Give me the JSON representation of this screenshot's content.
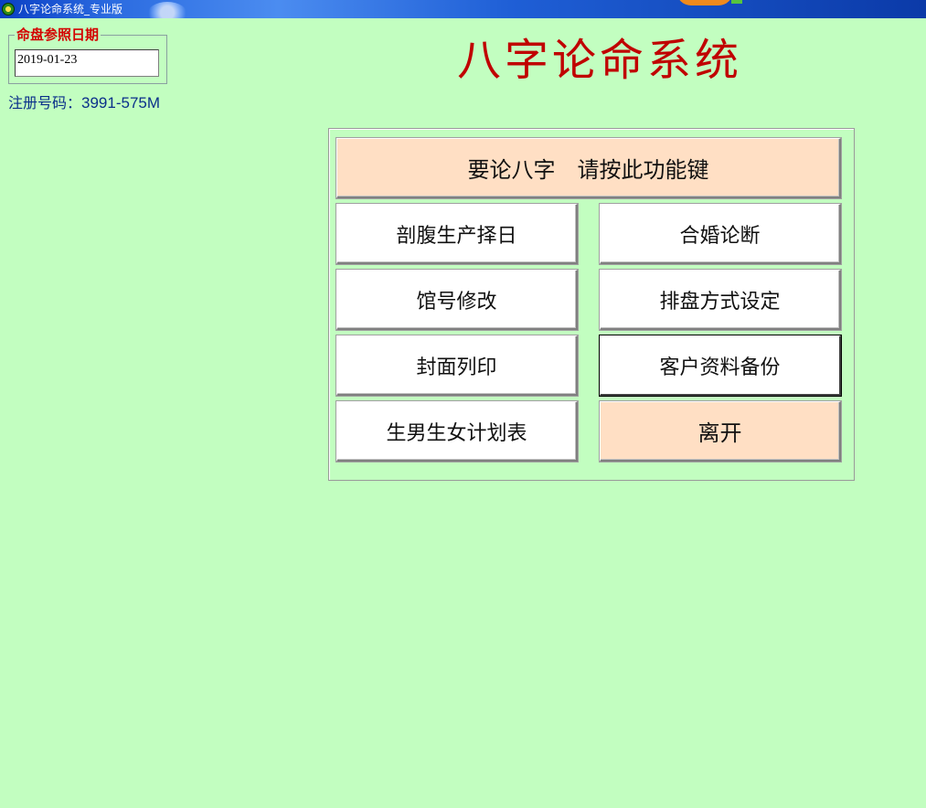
{
  "window": {
    "title": "八字论命系统_专业版",
    "icon": "app-logo-icon"
  },
  "date_group": {
    "legend": "命盘参照日期",
    "value": "2019-01-23"
  },
  "registration": {
    "label": "注册号码：",
    "value": "3991-575M"
  },
  "main_title": "八字论命系统",
  "buttons": {
    "bazi": "要论八字　请按此功能键",
    "caesarean": "剖腹生产择日",
    "marriage": "合婚论断",
    "shop_name": "馆号修改",
    "layout_settings": "排盘方式设定",
    "cover_print": "封面列印",
    "backup": "客户资料备份",
    "gender_plan": "生男生女计划表",
    "exit": "离开"
  },
  "colors": {
    "background": "#c2fec0",
    "title_red": "#c00000",
    "legend_red": "#d40000",
    "peach_button": "#ffdfc4",
    "reg_blue": "#0a2f8a"
  }
}
